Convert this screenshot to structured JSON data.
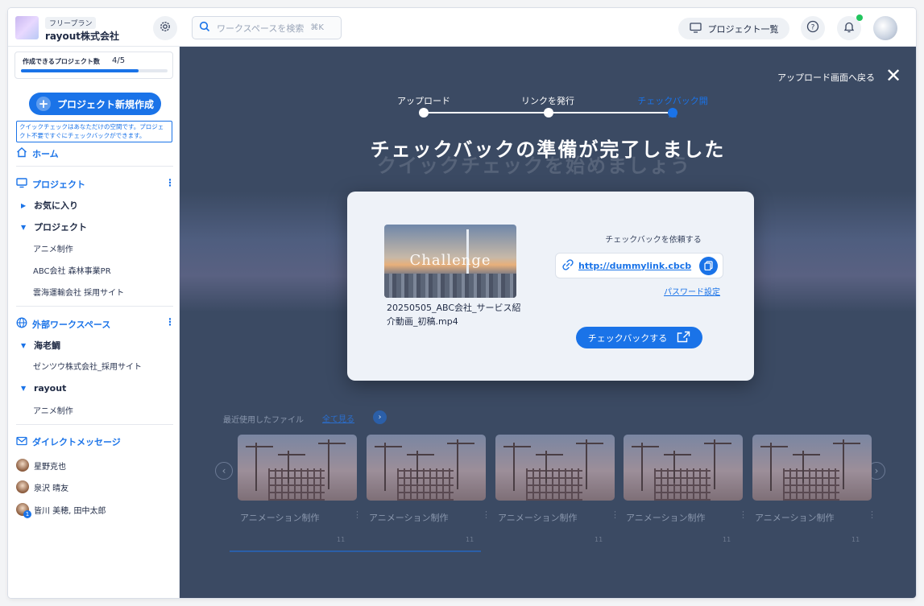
{
  "header": {
    "plan_badge": "フリープラン",
    "company": "rayout株式会社",
    "search_placeholder": "ワークスペースを検索",
    "search_shortcut": "⌘K",
    "project_list_label": "プロジェクト一覧"
  },
  "sidebar": {
    "quota_label": "作成できるプロジェクト数",
    "quota_value": "4/5",
    "quota_fraction": 0.8,
    "new_project_label": "プロジェクト新規作成",
    "tip_text": "クイックチェックはあなただけの空間です。プロジェクト不要ですぐにチェックバックができます。",
    "home_label": "ホーム",
    "projects_label": "プロジェクト",
    "favorites_label": "お気に入り",
    "projects_group_label": "プロジェクト",
    "projects": [
      "アニメ制作",
      "ABC会社 森林事業PR",
      "雲海運輸会社 採用サイト"
    ],
    "external_label": "外部ワークスペース",
    "external_groups": [
      {
        "name": "海老鯛",
        "items": [
          "ゼンツウ株式会社_採用サイト"
        ]
      },
      {
        "name": "rayout",
        "items": [
          "アニメ制作"
        ]
      }
    ],
    "dm_label": "ダイレクトメッセージ",
    "dms": [
      {
        "name": "星野克也",
        "badge": ""
      },
      {
        "name": "泉沢 晴友",
        "badge": ""
      },
      {
        "name": "皆川 美穂, 田中太郎",
        "badge": "1"
      }
    ]
  },
  "main": {
    "back_label": "アップロード画面へ戻る",
    "ghost_title": "クイックチェックを始めましょう",
    "steps": [
      {
        "label": "アップロード",
        "active": false
      },
      {
        "label": "リンクを発行",
        "active": false
      },
      {
        "label": "チェックバック開始",
        "active": true
      }
    ],
    "title": "チェックバックの準備が完了しました",
    "modal": {
      "thumbnail_text": "Challenge",
      "filename": "20250505_ABC会社_サービス紹介動画_初稿.mp4",
      "request_label": "チェックバックを依頼する",
      "link": "http://dummylink.cbcb",
      "password_label": "パスワード設定",
      "checkback_label": "チェックバックする"
    },
    "recent": {
      "label": "最近使用したファイル",
      "see_all": "全て見る",
      "cards": [
        {
          "title": "アニメーション制作",
          "meta": "11"
        },
        {
          "title": "アニメーション制作",
          "meta": "11"
        },
        {
          "title": "アニメーション制作",
          "meta": "11"
        },
        {
          "title": "アニメーション制作",
          "meta": "11"
        },
        {
          "title": "アニメーション制作",
          "meta": "11"
        }
      ]
    }
  },
  "colors": {
    "accent": "#1a73e8",
    "overlay": "#3b4a63",
    "online": "#22c55e"
  }
}
